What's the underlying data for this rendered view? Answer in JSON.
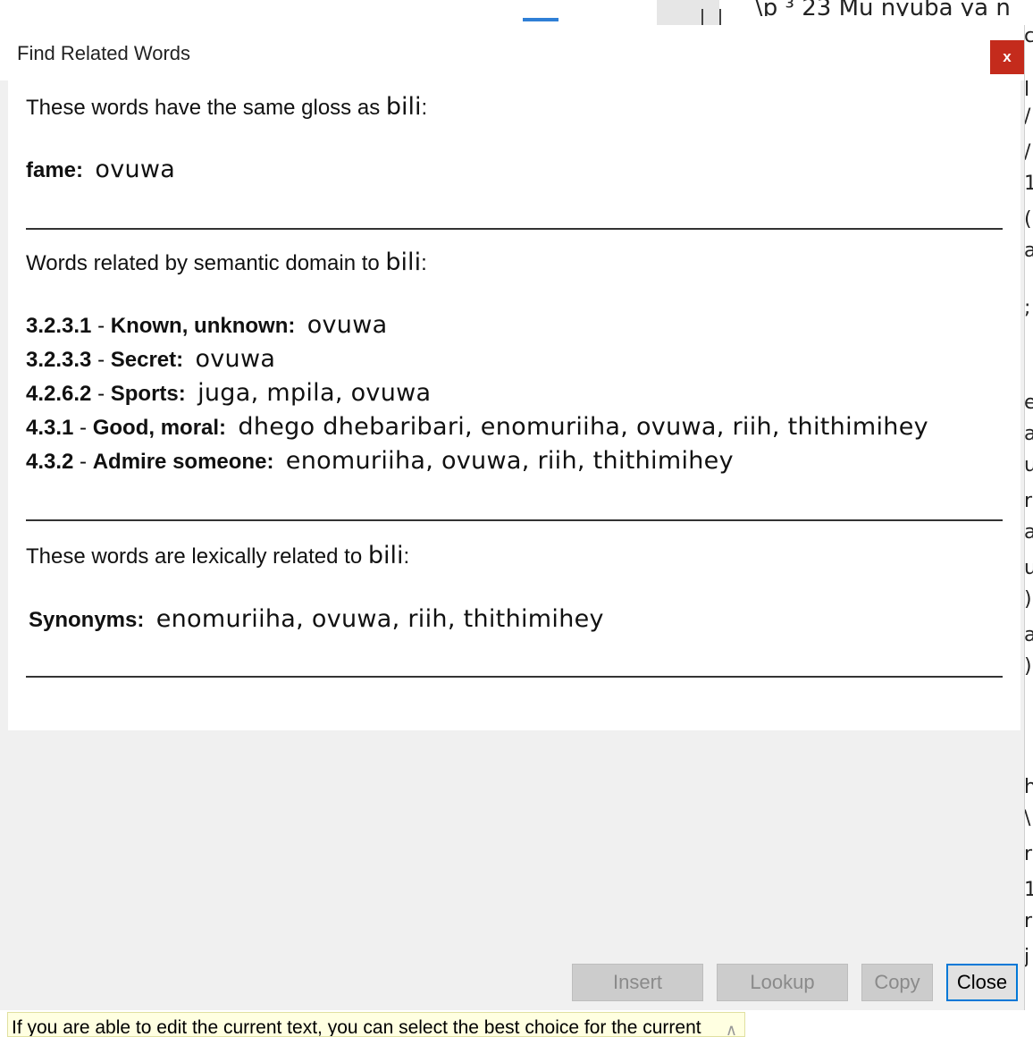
{
  "background": {
    "top_fragment": "\\p ³ 23 Mu nyuba ya n",
    "right_chars": [
      "c",
      "l",
      "/",
      "/",
      "1",
      "(",
      "a",
      ";",
      "e",
      "a",
      "u",
      "r",
      "a",
      "u",
      ")",
      "a",
      ")",
      "h",
      "\\",
      "r",
      "1",
      "r",
      "j"
    ]
  },
  "dialog": {
    "title": "Find Related Words",
    "close_icon_label": "x",
    "same_gloss": {
      "intro": "These words have the same gloss as",
      "word": "bili",
      "suffix": ":",
      "entries": [
        {
          "label": "fame:",
          "values": "ovuwa"
        }
      ]
    },
    "semantic": {
      "intro": "Words related by semantic domain to",
      "word": "bili",
      "suffix": ":",
      "entries": [
        {
          "code": "3.2.3.1",
          "label": "Known, unknown:",
          "values": "ovuwa"
        },
        {
          "code": "3.2.3.3",
          "label": "Secret:",
          "values": "ovuwa"
        },
        {
          "code": "4.2.6.2",
          "label": "Sports:",
          "values": "juga, mpila, ovuwa"
        },
        {
          "code": "4.3.1",
          "label": "Good, moral:",
          "values": "dhego dhebaribari, enomuriiha, ovuwa, riih, thithimihey"
        },
        {
          "code": "4.3.2",
          "label": "Admire someone:",
          "values": "enomuriiha, ovuwa, riih, thithimihey"
        }
      ]
    },
    "lexical": {
      "intro": "These words are lexically related to",
      "word": "bili",
      "suffix": ":",
      "entries": [
        {
          "label": "Synonyms:",
          "values": "enomuriiha, ovuwa, riih, thithimihey"
        }
      ]
    },
    "buttons": {
      "insert": "Insert",
      "lookup": "Lookup",
      "copy": "Copy",
      "close": "Close"
    }
  },
  "tooltip": {
    "text": "If you are able to edit the current text, you can select the best choice for the current"
  }
}
